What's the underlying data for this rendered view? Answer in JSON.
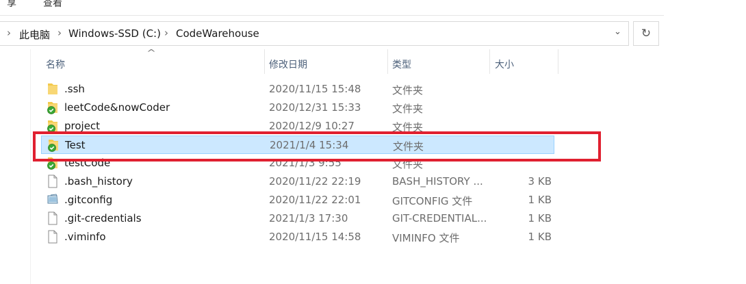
{
  "ribbon": {
    "tab_share": "享",
    "tab_view": "查看"
  },
  "address_bar": {
    "crumbs": [
      "此电脑",
      "Windows-SSD (C:)",
      "CodeWarehouse"
    ],
    "separator": "›",
    "dropdown_glyph": "⌄",
    "refresh_glyph": "↻"
  },
  "columns": {
    "name": "名称",
    "modified": "修改日期",
    "type": "类型",
    "size": "大小",
    "sort_glyph": "^"
  },
  "files": [
    {
      "name": ".ssh",
      "modified": "2020/11/15 15:48",
      "type": "文件夹",
      "size": "",
      "icon": "folder-icon"
    },
    {
      "name": "leetCode&nowCoder",
      "modified": "2020/12/31 15:33",
      "type": "文件夹",
      "size": "",
      "icon": "git-folder-icon"
    },
    {
      "name": "project",
      "modified": "2020/12/9 10:27",
      "type": "文件夹",
      "size": "",
      "icon": "git-folder-icon"
    },
    {
      "name": "Test",
      "modified": "2021/1/4 15:34",
      "type": "文件夹",
      "size": "",
      "icon": "git-folder-icon",
      "selected": true
    },
    {
      "name": "testCode",
      "modified": "2021/1/3 9:55",
      "type": "文件夹",
      "size": "",
      "icon": "git-folder-icon"
    },
    {
      "name": ".bash_history",
      "modified": "2020/11/22 22:19",
      "type": "BASH_HISTORY ...",
      "size": "3 KB",
      "icon": "file-icon"
    },
    {
      "name": ".gitconfig",
      "modified": "2020/11/22 22:01",
      "type": "GITCONFIG 文件",
      "size": "1 KB",
      "icon": "config-file-icon"
    },
    {
      "name": ".git-credentials",
      "modified": "2021/1/3 17:30",
      "type": "GIT-CREDENTIAL...",
      "size": "1 KB",
      "icon": "file-icon"
    },
    {
      "name": ".viminfo",
      "modified": "2020/11/15 14:58",
      "type": "VIMINFO 文件",
      "size": "1 KB",
      "icon": "file-icon"
    }
  ],
  "colors": {
    "selection_fill": "#cce8ff",
    "selection_border": "#99d1ff",
    "annotation_box": "#e02030",
    "folder_yellow": "#f3c94a",
    "git_badge_green": "#3aa935"
  }
}
